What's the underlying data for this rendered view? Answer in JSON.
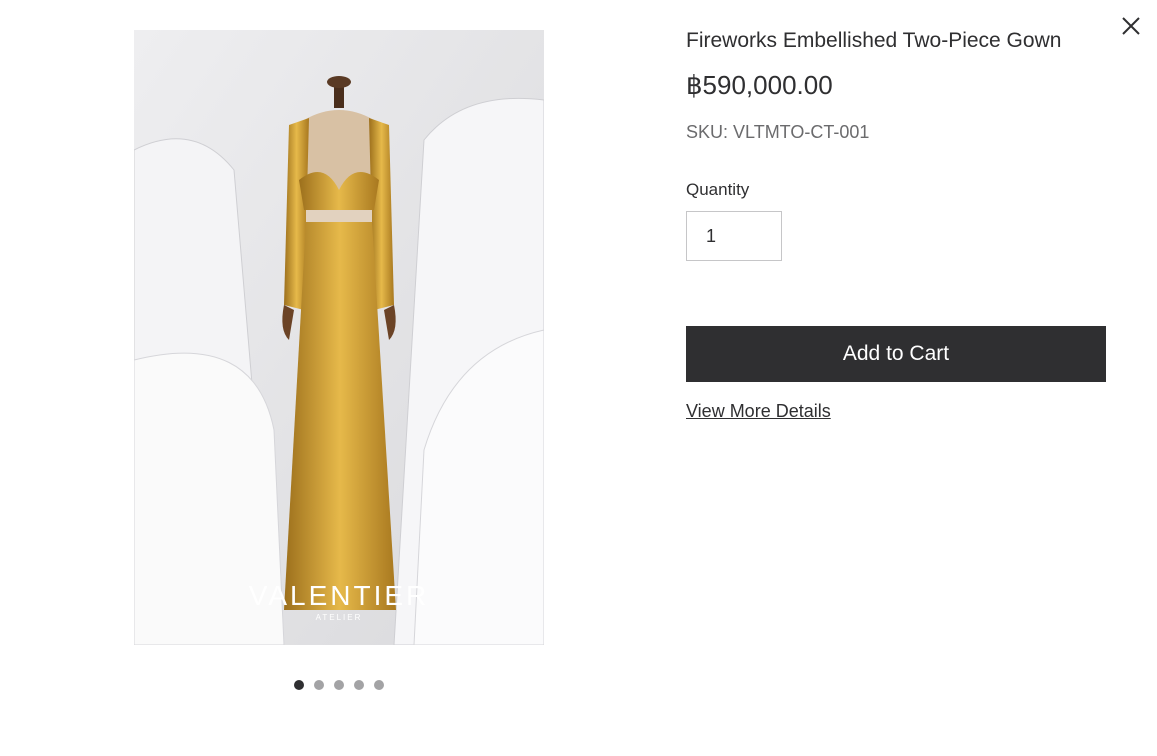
{
  "product": {
    "title": "Fireworks Embellished Two-Piece Gown",
    "price": "฿590,000.00",
    "sku": "SKU: VLTMTO-CT-001"
  },
  "image": {
    "brand_name": "VALENTIER",
    "brand_sub": "ATELIER",
    "slide_count": 5,
    "active_slide": 1
  },
  "quantity": {
    "label": "Quantity",
    "value": "1"
  },
  "actions": {
    "add_to_cart": "Add to Cart",
    "view_details": "View More Details"
  },
  "icons": {
    "close": "close-icon"
  },
  "colors": {
    "primary": "#2f2f31",
    "dot_inactive": "#a3a3a5",
    "gown_gold": "#c99a2e"
  }
}
